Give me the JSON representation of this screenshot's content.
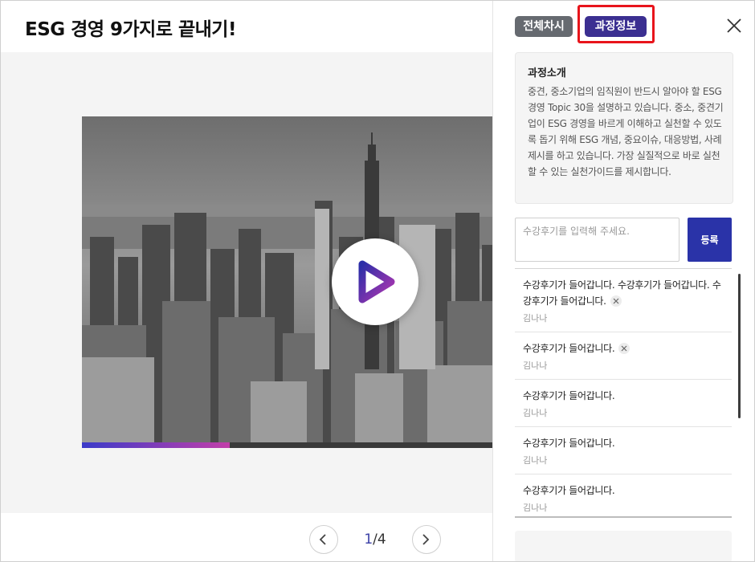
{
  "header": {
    "title": "ESG 경영 9가지로 끝내기!"
  },
  "player": {
    "progress": 0.36
  },
  "pager": {
    "current": "1",
    "total": "/4"
  },
  "tabs": {
    "all_label": "전체차시",
    "info_label": "과정정보"
  },
  "intro": {
    "title": "과정소개",
    "body": "중견, 중소기업의 임직원이 반드시 알아야 할 ESG경영 Topic 30을 설명하고 있습니다. 중소, 중견기업이 ESG 경영을 바르게 이해하고 실천할 수 있도록 돕기 위해 ESG 개념, 중요이슈, 대응방법, 사례제시를 하고 있습니다. 가장 실질적으로 바로 실천할 수 있는 실천가이드를 제시합니다."
  },
  "review_form": {
    "placeholder": "수강후기를 입력해 주세요.",
    "submit_label": "등록"
  },
  "reviews": [
    {
      "text": "수강후기가 들어갑니다. 수강후기가 들어갑니다. 수강후기가 들어갑니다.",
      "author": "김나나"
    },
    {
      "text": "수강후기가 들어갑니다.",
      "author": "김나나"
    },
    {
      "text": "수강후기가 들어갑니다.",
      "author": "김나나"
    },
    {
      "text": "수강후기가 들어갑니다.",
      "author": "김나나"
    },
    {
      "text": "수강후기가 들어갑니다.",
      "author": "김나나"
    }
  ],
  "colors": {
    "accent": "#2a33a8",
    "tab_active": "#3b2f91",
    "highlight": "#e8141b"
  },
  "icons": [
    "play-icon",
    "close-icon",
    "chevron-left-icon",
    "chevron-right-icon",
    "delete-icon"
  ]
}
